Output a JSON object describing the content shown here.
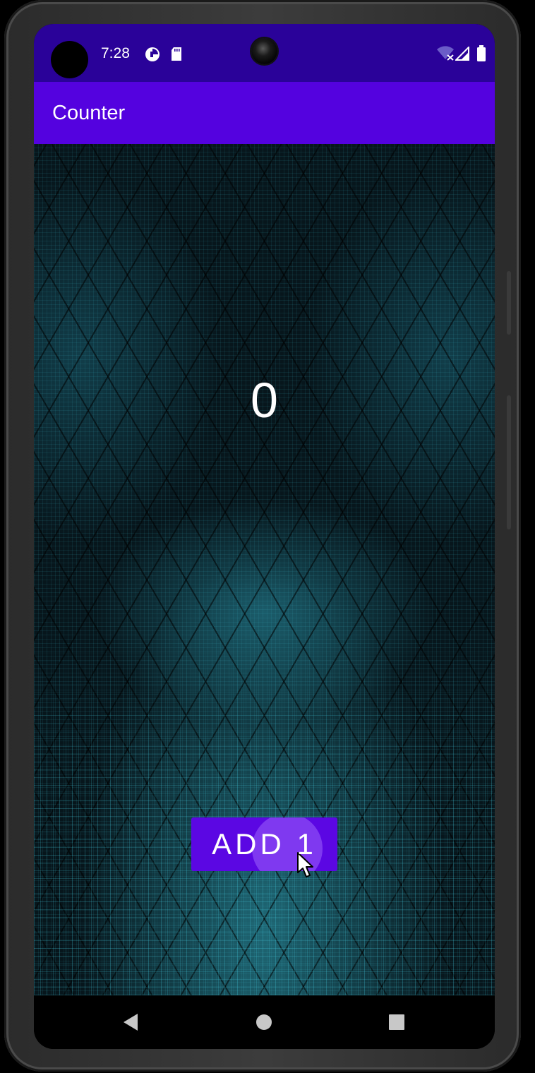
{
  "status_bar": {
    "time": "7:28",
    "icons": [
      "avatar-icon",
      "data-saver-icon",
      "sd-card-icon",
      "wifi-off-icon",
      "cell-signal-icon",
      "battery-icon"
    ]
  },
  "app_bar": {
    "title": "Counter"
  },
  "counter": {
    "value": "0"
  },
  "add_button": {
    "label": "ADD 1"
  },
  "nav_bar": {
    "icons": [
      "back-icon",
      "home-icon",
      "recents-icon"
    ]
  },
  "colors": {
    "status_bar": "#2a0299",
    "app_bar": "#5402df",
    "button": "#5b07e3",
    "text": "#ffffff"
  }
}
